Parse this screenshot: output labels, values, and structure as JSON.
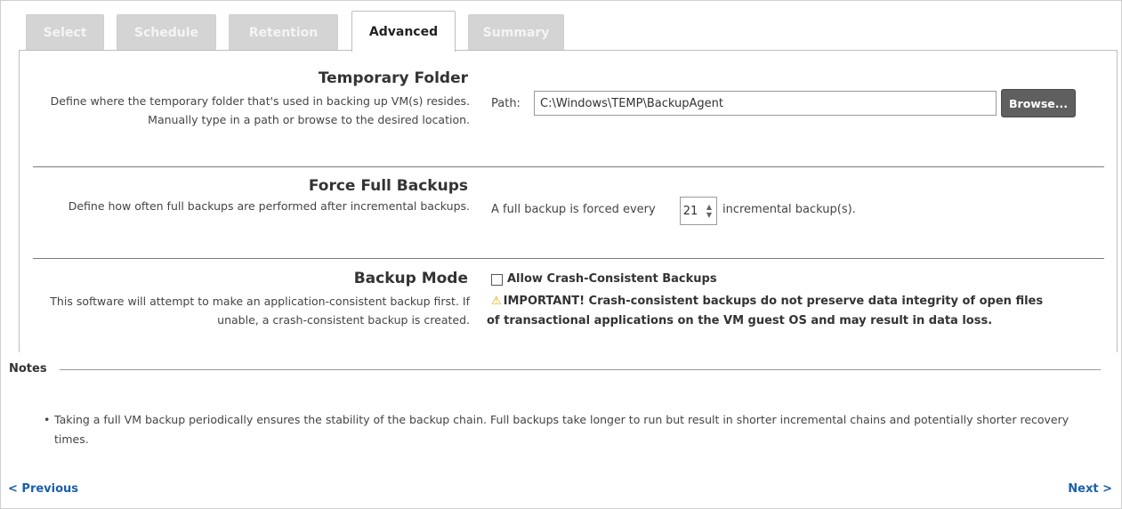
{
  "tabs": [
    {
      "label": "Select",
      "active": false
    },
    {
      "label": "Schedule",
      "active": false
    },
    {
      "label": "Retention",
      "active": false
    },
    {
      "label": "Advanced",
      "active": true
    },
    {
      "label": "Summary",
      "active": false
    }
  ],
  "temporary_folder": {
    "title": "Temporary Folder",
    "description": "Define where the temporary folder that's used in backing up VM(s) resides. Manually type in a path or browse to the desired location.",
    "path_label": "Path:",
    "path_value": "C:\\Windows\\TEMP\\BackupAgent",
    "browse_label": "Browse..."
  },
  "force_full_backups": {
    "title": "Force Full Backups",
    "description": "Define how often full backups are performed after incremental backups.",
    "prefix_text": "A full backup is forced every",
    "interval_value": "21",
    "suffix_text": "incremental backup(s)."
  },
  "backup_mode": {
    "title": "Backup Mode",
    "description": "This software will attempt to make an application-consistent backup first. If unable, a crash-consistent backup is created.",
    "checkbox_label": "Allow Crash-Consistent Backups",
    "checkbox_checked": false,
    "warning_line1": "IMPORTANT! Crash-consistent backups do not preserve data integrity of open files",
    "warning_line2": "of transactional applications on the VM guest OS and may result in data loss.",
    "warning_icon": "warning-triangle-icon"
  },
  "notes": {
    "label": "Notes",
    "items": [
      "Taking a full VM backup periodically ensures the stability of the backup chain. Full backups take longer to run but result in shorter incremental chains and potentially shorter recovery times."
    ]
  },
  "navigation": {
    "previous_label": "< Previous",
    "next_label": "Next >"
  },
  "colors": {
    "link": "#1b5fa8",
    "warning": "#e6a800",
    "button": "#5f5f5f",
    "inactive_tab": "#d4d4d4"
  }
}
